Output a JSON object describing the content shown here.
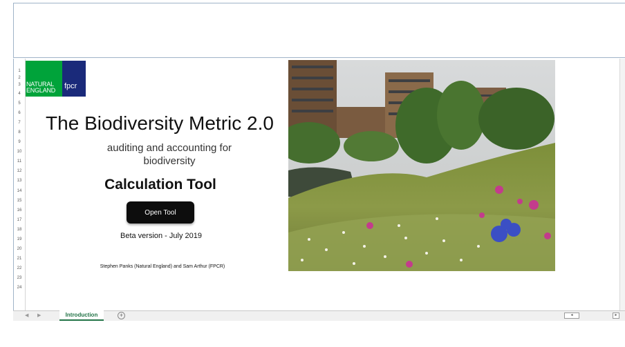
{
  "logo": {
    "natural_line1": "NATURAL",
    "natural_line2": "ENGLAND",
    "fpcr": "fpcr",
    "green_color": "#00a33a",
    "blue_color": "#1a2a7a"
  },
  "title": "The Biodiversity Metric 2.0",
  "subtitle": "auditing and accounting for biodiversity",
  "calculation_heading": "Calculation Tool",
  "open_button_label": "Open Tool",
  "version_text": "Beta version - July 2019",
  "authors_text": "Stephen Panks (Natural England) and Sam Arthur (FPCR)",
  "row_numbers": [
    "1",
    "2",
    "3",
    "4",
    "5",
    "6",
    "7",
    "8",
    "9",
    "10",
    "11",
    "12",
    "13",
    "14",
    "15",
    "16",
    "17",
    "18",
    "19",
    "20",
    "21",
    "22",
    "23",
    "24"
  ],
  "tabs": {
    "active_sheet": "Introduction",
    "add_sheet_icon": "plus-circle-icon",
    "accent_color": "#217346"
  }
}
